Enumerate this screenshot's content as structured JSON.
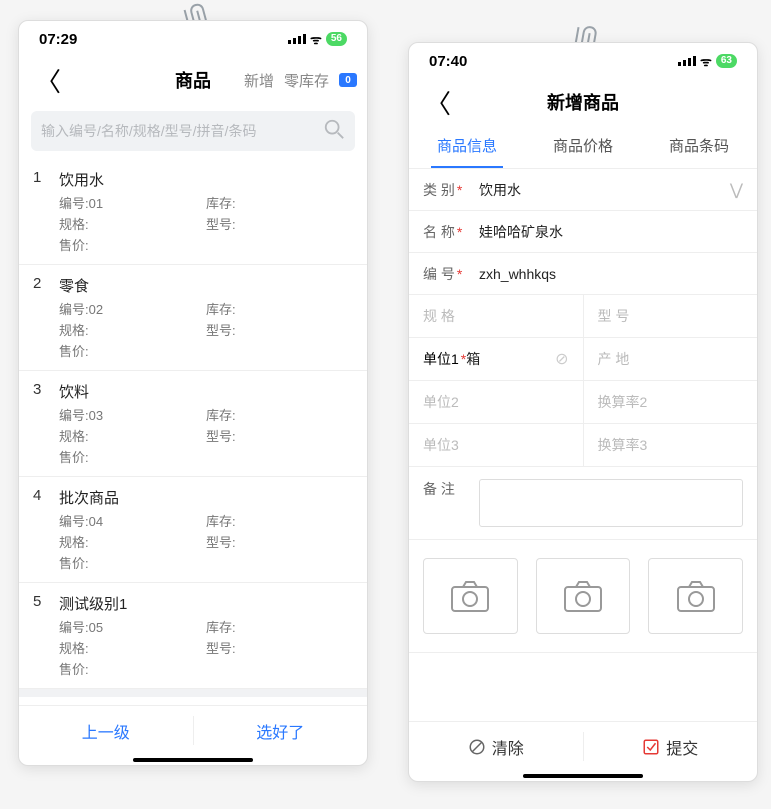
{
  "left": {
    "status": {
      "time": "07:29",
      "battery": "56"
    },
    "nav": {
      "title": "商品",
      "add": "新增",
      "zero": "零库存",
      "badge": "0"
    },
    "search_placeholder": "输入编号/名称/规格/型号/拼音/条码",
    "labels": {
      "code": "编号:",
      "stock": "库存:",
      "spec": "规格:",
      "model": "型号:",
      "price": "售价:"
    },
    "items": [
      {
        "idx": "1",
        "name": "饮用水",
        "code": "01"
      },
      {
        "idx": "2",
        "name": "零食",
        "code": "02"
      },
      {
        "idx": "3",
        "name": "饮料",
        "code": "03"
      },
      {
        "idx": "4",
        "name": "批次商品",
        "code": "04"
      },
      {
        "idx": "5",
        "name": "测试级别1",
        "code": "05"
      }
    ],
    "footer": {
      "prev": "上一级",
      "ok": "选好了"
    }
  },
  "right": {
    "status": {
      "time": "07:40",
      "battery": "63"
    },
    "nav": {
      "title": "新增商品"
    },
    "tabs": {
      "info": "商品信息",
      "price": "商品价格",
      "barcode": "商品条码"
    },
    "form": {
      "cat_label": "类 别",
      "cat_value": "饮用水",
      "name_label": "名 称",
      "name_value": "娃哈哈矿泉水",
      "code_label": "编 号",
      "code_value": "zxh_whhkqs",
      "spec_label": "规 格",
      "model_label": "型 号",
      "unit1_label": "单位1",
      "unit1_value": "箱",
      "origin_label": "产 地",
      "unit2_label": "单位2",
      "rate2_label": "换算率2",
      "unit3_label": "单位3",
      "rate3_label": "换算率3",
      "notes_label": "备 注"
    },
    "footer": {
      "clear": "清除",
      "submit": "提交"
    }
  }
}
